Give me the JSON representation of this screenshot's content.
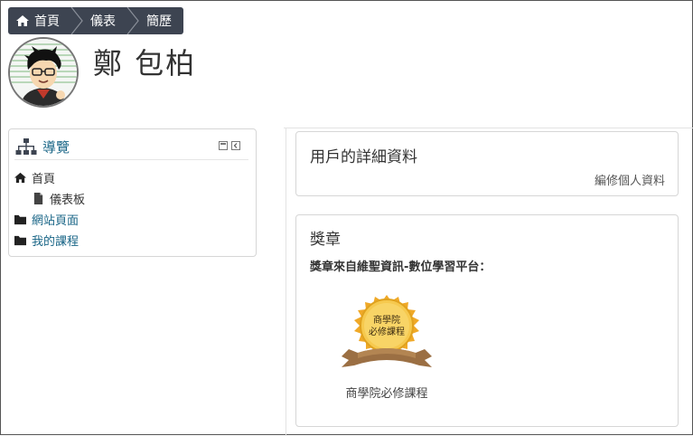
{
  "breadcrumb": {
    "items": [
      {
        "label": "首頁",
        "icon": "home-icon"
      },
      {
        "label": "儀表"
      },
      {
        "label": "簡歷"
      }
    ]
  },
  "profile": {
    "name": "鄭 包柏"
  },
  "navigation": {
    "title": "導覽",
    "items": [
      {
        "label": "首頁",
        "icon": "home-icon",
        "link": false
      },
      {
        "label": "儀表板",
        "icon": "document-icon",
        "link": false
      },
      {
        "label": "網站頁面",
        "icon": "folder-icon",
        "link": true
      },
      {
        "label": "我的課程",
        "icon": "folder-icon",
        "link": true
      }
    ]
  },
  "user_details": {
    "title": "用戶的詳細資料",
    "edit_link": "編修個人資料"
  },
  "badges": {
    "title": "獎章",
    "source_text": "獎章來自維聖資訊-數位學習平台：",
    "items": [
      {
        "name": "商學院必修課程",
        "badge_text_line1": "商學院",
        "badge_text_line2": "必修課程"
      }
    ]
  },
  "colors": {
    "breadcrumb_bg": "#3d4451",
    "link": "#1a6687",
    "badge_gold": "#f2b73a",
    "ribbon_brown": "#9b6f43"
  }
}
